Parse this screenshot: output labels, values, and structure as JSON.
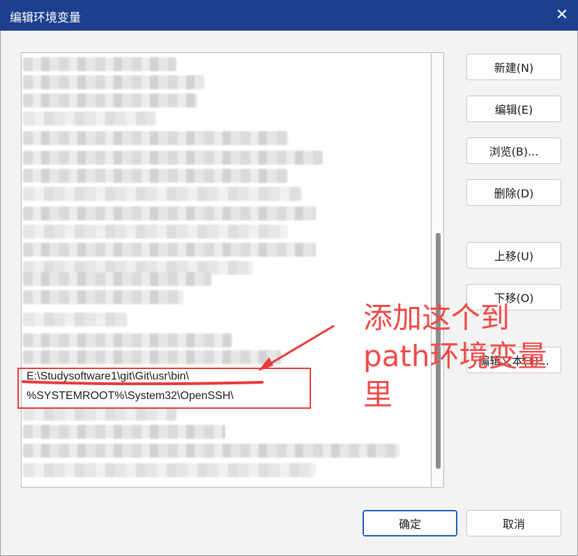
{
  "window": {
    "title": "编辑环境变量",
    "close_symbol": "✕"
  },
  "list": {
    "items": [
      "E:\\Studysoftware1\\git\\Git\\usr\\bin\\",
      "%SYSTEMROOT%\\System32\\OpenSSH\\"
    ]
  },
  "buttons": {
    "new": "新建(N)",
    "edit": "编辑(E)",
    "browse": "浏览(B)...",
    "delete": "删除(D)",
    "move_up": "上移(U)",
    "move_down": "下移(O)",
    "edit_text": "编辑文本(T)...",
    "ok": "确定",
    "cancel": "取消"
  },
  "annotation": {
    "text": "添加这个到path环境变量里",
    "color": "#f04a4a"
  },
  "colors": {
    "titlebar": "#1c3f8f",
    "highlight_box": "#e83a3a",
    "primary_border": "#1c5fb8"
  },
  "icons": {
    "close": "close-icon"
  }
}
